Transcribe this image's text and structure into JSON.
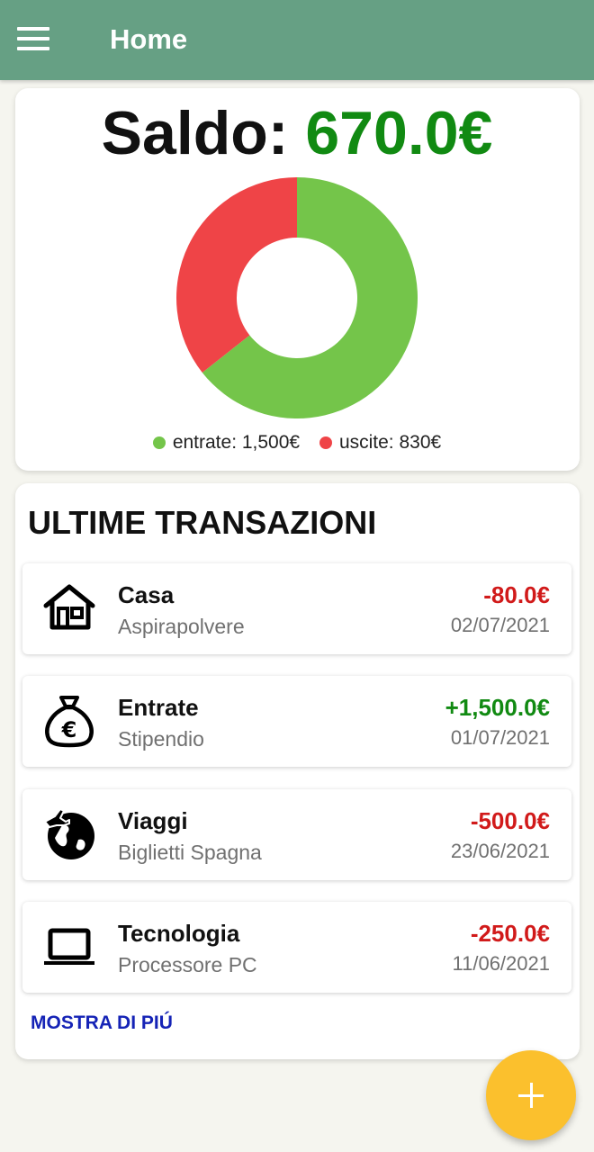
{
  "appbar": {
    "title": "Home",
    "menu_icon": "hamburger-menu-icon"
  },
  "balance": {
    "label": "Saldo:",
    "amount": "670.0€",
    "amount_color": "#118a12"
  },
  "chart_data": {
    "type": "pie",
    "categories": [
      "entrate",
      "uscite"
    ],
    "values": [
      1500,
      830
    ],
    "colors": [
      "#74c54a",
      "#ef4447"
    ],
    "legend": [
      "entrate: 1,500€",
      "uscite: 830€"
    ],
    "legend_placement": "bottom"
  },
  "transactions": {
    "heading": "ULTIME TRANSAZIONI",
    "items": [
      {
        "icon": "house-icon",
        "category": "Casa",
        "description": "Aspirapolvere",
        "amount": "-80.0€",
        "date": "02/07/2021",
        "color": "#d11a1a"
      },
      {
        "icon": "money-bag-euro-icon",
        "category": "Entrate",
        "description": "Stipendio",
        "amount": "+1,500.0€",
        "date": "01/07/2021",
        "color": "#118a12"
      },
      {
        "icon": "travel-globe-icon",
        "category": "Viaggi",
        "description": "Biglietti Spagna",
        "amount": "-500.0€",
        "date": "23/06/2021",
        "color": "#d11a1a"
      },
      {
        "icon": "laptop-icon",
        "category": "Tecnologia",
        "description": "Processore PC",
        "amount": "-250.0€",
        "date": "11/06/2021",
        "color": "#d11a1a"
      }
    ],
    "show_more": "MOSTRA DI PIÚ"
  },
  "fab": {
    "icon": "plus-icon",
    "color": "#fbc02d"
  }
}
